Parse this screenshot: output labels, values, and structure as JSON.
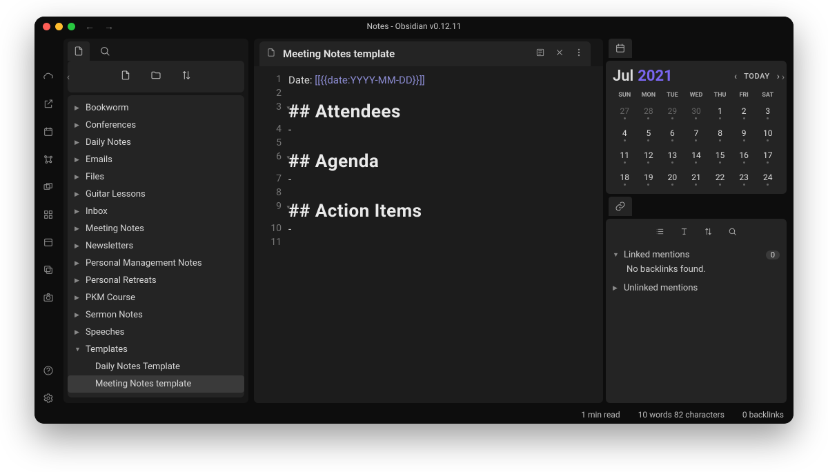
{
  "titlebar": {
    "title": "Notes - Obsidian v0.12.11"
  },
  "active_tab": {
    "title": "Meeting Notes template"
  },
  "editor": {
    "lines": [
      {
        "n": 1,
        "type": "date"
      },
      {
        "n": 2,
        "type": "blank"
      },
      {
        "n": 3,
        "type": "h2",
        "text": "## Attendees",
        "fold": true
      },
      {
        "n": 4,
        "type": "dash"
      },
      {
        "n": 5,
        "type": "blank"
      },
      {
        "n": 6,
        "type": "h2",
        "text": "## Agenda",
        "fold": true
      },
      {
        "n": 7,
        "type": "dash"
      },
      {
        "n": 8,
        "type": "blank"
      },
      {
        "n": 9,
        "type": "h2",
        "text": "## Action Items",
        "fold": true
      },
      {
        "n": 10,
        "type": "dash"
      },
      {
        "n": 11,
        "type": "blank"
      }
    ],
    "date_prefix": "Date: ",
    "date_open": "[[",
    "date_body": "{{date:YYYY-MM-DD}}",
    "date_close": "]]"
  },
  "folders": [
    {
      "name": "Bookworm"
    },
    {
      "name": "Conferences"
    },
    {
      "name": "Daily Notes"
    },
    {
      "name": "Emails"
    },
    {
      "name": "Files"
    },
    {
      "name": "Guitar Lessons"
    },
    {
      "name": "Inbox"
    },
    {
      "name": "Meeting Notes"
    },
    {
      "name": "Newsletters"
    },
    {
      "name": "Personal Management Notes"
    },
    {
      "name": "Personal Retreats"
    },
    {
      "name": "PKM Course"
    },
    {
      "name": "Sermon Notes"
    },
    {
      "name": "Speeches"
    }
  ],
  "open_folder": {
    "name": "Templates",
    "files": [
      {
        "name": "Daily Notes Template",
        "active": false
      },
      {
        "name": "Meeting Notes template",
        "active": true
      }
    ]
  },
  "calendar": {
    "month": "Jul",
    "year": "2021",
    "today_label": "TODAY",
    "dow": [
      "SUN",
      "MON",
      "TUE",
      "WED",
      "THU",
      "FRI",
      "SAT"
    ],
    "days": [
      {
        "d": "27",
        "dim": true
      },
      {
        "d": "28",
        "dim": true
      },
      {
        "d": "29",
        "dim": true
      },
      {
        "d": "30",
        "dim": true
      },
      {
        "d": "1"
      },
      {
        "d": "2"
      },
      {
        "d": "3"
      },
      {
        "d": "4"
      },
      {
        "d": "5"
      },
      {
        "d": "6"
      },
      {
        "d": "7"
      },
      {
        "d": "8"
      },
      {
        "d": "9"
      },
      {
        "d": "10"
      },
      {
        "d": "11"
      },
      {
        "d": "12"
      },
      {
        "d": "13"
      },
      {
        "d": "14"
      },
      {
        "d": "15"
      },
      {
        "d": "16"
      },
      {
        "d": "17"
      },
      {
        "d": "18"
      },
      {
        "d": "19"
      },
      {
        "d": "20"
      },
      {
        "d": "21"
      },
      {
        "d": "22"
      },
      {
        "d": "23"
      },
      {
        "d": "24"
      }
    ]
  },
  "backlinks": {
    "linked_label": "Linked mentions",
    "linked_count": "0",
    "empty": "No backlinks found.",
    "unlinked_label": "Unlinked mentions"
  },
  "status": {
    "read": "1 min read",
    "words": "10 words 82 characters",
    "links": "0 backlinks"
  }
}
